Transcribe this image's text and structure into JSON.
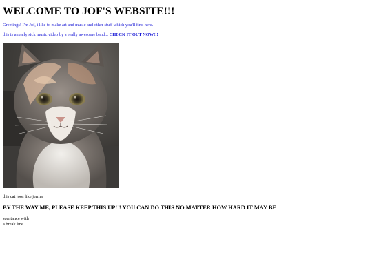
{
  "header": {
    "title": "WELCOME TO JOF'S WEBSITE!!!"
  },
  "intro": {
    "greeting": "Greetings! I'm Jof, i like to make art and music and other stuff which you'll find here."
  },
  "music_link": {
    "text": "this is a really sick music video by a really awesome band... ",
    "emphasis": "CHECK IT OUT NOW!!!"
  },
  "cat": {
    "image": "cat-photo",
    "caption": "this cat loos like jerma"
  },
  "motivation": {
    "heading": "BY THE WAY ME, PLEASE KEEP THIS UP!!! YOU CAN DO THIS NO MATTER HOW HARD IT MAY BE"
  },
  "sentence": {
    "line1": "scentance with",
    "line2": "a break line"
  },
  "colors": {
    "link": "#1a1ad6",
    "text": "#000000",
    "background": "#ffffff"
  }
}
